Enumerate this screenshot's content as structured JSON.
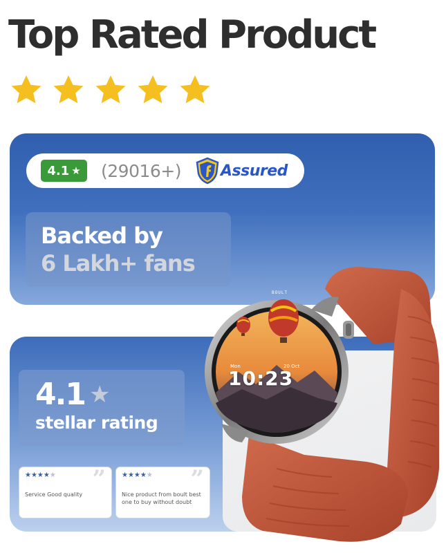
{
  "header": {
    "title": "Top Rated Product",
    "star_rating": 5,
    "star_count": 5,
    "star_color": "#f5bf1f"
  },
  "rating_pill": {
    "badge_value": "4.1",
    "badge_icon": "star-icon",
    "badge_color": "#3a9a3a",
    "review_count": "(29016+)",
    "assured_label": "Assured",
    "assured_icon": "f-assured-shield-icon"
  },
  "fans": {
    "line1": "Backed by",
    "line2": "6 Lakh+ fans"
  },
  "stellar": {
    "value": "4.1",
    "icon": "star-icon",
    "label": "stellar rating"
  },
  "reviews": [
    {
      "stars": 4,
      "text": "Service Good quality",
      "quote_icon": "quote-icon"
    },
    {
      "stars": 4,
      "text": "Nice product from boult best one to buy without  doubt",
      "quote_icon": "quote-icon"
    }
  ],
  "watch": {
    "brand": "BOULT",
    "day": "Mon",
    "date": "20 Oct",
    "time": "10:23",
    "strap_color": "#c4553a"
  }
}
